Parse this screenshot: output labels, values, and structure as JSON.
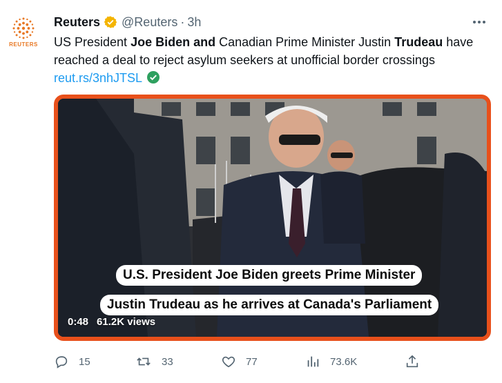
{
  "author": {
    "name": "Reuters",
    "handle": "@Reuters",
    "separator": "·",
    "time": "3h",
    "avatar_text": "REUTERS",
    "avatar_color": "#e87722",
    "verified_color": "#f4b400"
  },
  "tweet": {
    "text_parts": [
      {
        "t": "US President ",
        "b": false
      },
      {
        "t": "Joe Biden and",
        "b": true
      },
      {
        "t": " Canadian Prime Minister Justin ",
        "b": false
      },
      {
        "t": "Trudeau",
        "b": true
      },
      {
        "t": " have reached a deal to reject asylum seekers at unofficial border crossings ",
        "b": false
      }
    ],
    "link": "reut.rs/3nhJTSL",
    "link_color": "#1d9bf0"
  },
  "video": {
    "caption_line1": "U.S. President Joe Biden greets Prime Minister",
    "caption_line2": "Justin Trudeau as he arrives at Canada's Parliament",
    "duration": "0:48",
    "views": "61.2K views",
    "border_color": "#e8501b"
  },
  "actions": {
    "replies": "15",
    "retweets": "33",
    "likes": "77",
    "views": "73.6K"
  },
  "icons": [
    "reuters-logo-icon",
    "verified-badge-icon",
    "more-icon",
    "link-check-icon",
    "reply-icon",
    "retweet-icon",
    "like-icon",
    "views-icon",
    "share-icon"
  ]
}
